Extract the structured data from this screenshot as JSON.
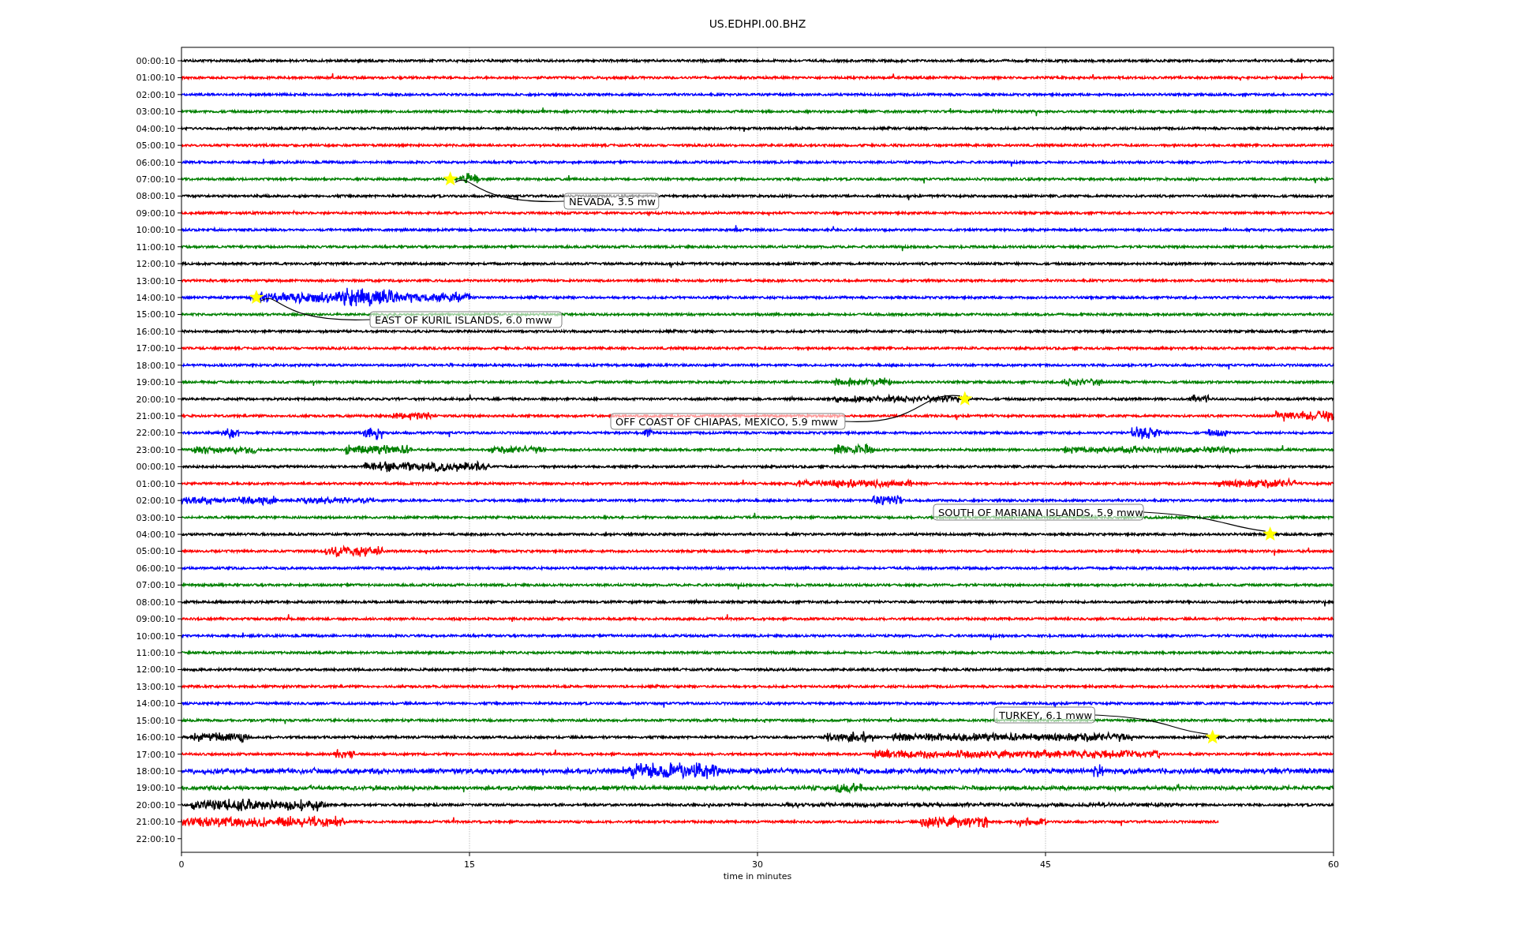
{
  "title": "US.EDHPI.00.BHZ",
  "rows": [
    {
      "label": "00:00:10",
      "color": "#000000"
    },
    {
      "label": "01:00:10",
      "color": "#ff0000"
    },
    {
      "label": "02:00:10",
      "color": "#0000ff"
    },
    {
      "label": "03:00:10",
      "color": "#008000"
    },
    {
      "label": "04:00:10",
      "color": "#000000"
    },
    {
      "label": "05:00:10",
      "color": "#ff0000"
    },
    {
      "label": "06:00:10",
      "color": "#0000ff"
    },
    {
      "label": "07:00:10",
      "color": "#008000"
    },
    {
      "label": "08:00:10",
      "color": "#000000"
    },
    {
      "label": "09:00:10",
      "color": "#ff0000"
    },
    {
      "label": "10:00:10",
      "color": "#0000ff"
    },
    {
      "label": "11:00:10",
      "color": "#008000"
    },
    {
      "label": "12:00:10",
      "color": "#000000"
    },
    {
      "label": "13:00:10",
      "color": "#ff0000"
    },
    {
      "label": "14:00:10",
      "color": "#0000ff"
    },
    {
      "label": "15:00:10",
      "color": "#008000"
    },
    {
      "label": "16:00:10",
      "color": "#000000"
    },
    {
      "label": "17:00:10",
      "color": "#ff0000"
    },
    {
      "label": "18:00:10",
      "color": "#0000ff"
    },
    {
      "label": "19:00:10",
      "color": "#008000"
    },
    {
      "label": "20:00:10",
      "color": "#000000"
    },
    {
      "label": "21:00:10",
      "color": "#ff0000"
    },
    {
      "label": "22:00:10",
      "color": "#0000ff"
    },
    {
      "label": "23:00:10",
      "color": "#008000"
    },
    {
      "label": "00:00:10",
      "color": "#000000"
    },
    {
      "label": "01:00:10",
      "color": "#ff0000"
    },
    {
      "label": "02:00:10",
      "color": "#0000ff"
    },
    {
      "label": "03:00:10",
      "color": "#008000"
    },
    {
      "label": "04:00:10",
      "color": "#000000"
    },
    {
      "label": "05:00:10",
      "color": "#ff0000"
    },
    {
      "label": "06:00:10",
      "color": "#0000ff"
    },
    {
      "label": "07:00:10",
      "color": "#008000"
    },
    {
      "label": "08:00:10",
      "color": "#000000"
    },
    {
      "label": "09:00:10",
      "color": "#ff0000"
    },
    {
      "label": "10:00:10",
      "color": "#0000ff"
    },
    {
      "label": "11:00:10",
      "color": "#008000"
    },
    {
      "label": "12:00:10",
      "color": "#000000"
    },
    {
      "label": "13:00:10",
      "color": "#ff0000"
    },
    {
      "label": "14:00:10",
      "color": "#0000ff"
    },
    {
      "label": "15:00:10",
      "color": "#008000"
    },
    {
      "label": "16:00:10",
      "color": "#000000"
    },
    {
      "label": "17:00:10",
      "color": "#ff0000"
    },
    {
      "label": "18:00:10",
      "color": "#0000ff"
    },
    {
      "label": "19:00:10",
      "color": "#008000"
    },
    {
      "label": "20:00:10",
      "color": "#000000"
    },
    {
      "label": "21:00:10",
      "color": "#ff0000",
      "level": 0.9
    },
    {
      "label": "22:00:10"
    }
  ],
  "xticks": [
    "0",
    "15",
    "30",
    "45",
    "60"
  ],
  "xlabel": "time in minutes",
  "events": [
    {
      "label": "NEVADA, 3.5 mw"
    },
    {
      "label": "EAST OF KURIL ISLANDS, 6.0 mww"
    },
    {
      "label": "OFF COAST OF CHIAPAS, MEXICO, 5.9 mww"
    },
    {
      "label": "SOUTH OF MARIANA ISLANDS, 5.9 mww"
    },
    {
      "label": "TURKEY, 6.1 mww"
    }
  ]
}
